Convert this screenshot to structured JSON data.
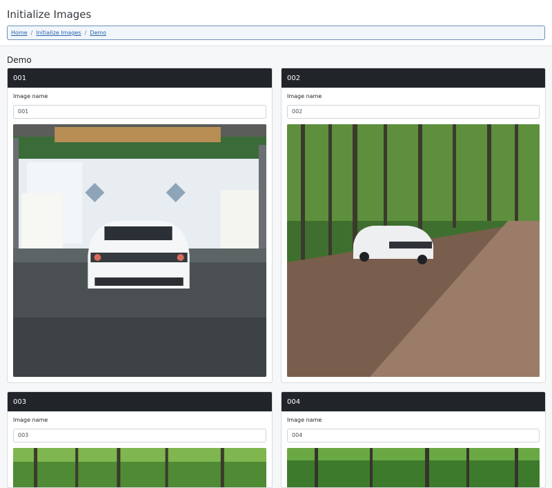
{
  "header": {
    "title": "Initialize Images",
    "breadcrumb": [
      {
        "label": "Home"
      },
      {
        "label": "Initialize Images"
      },
      {
        "label": "Demo"
      }
    ]
  },
  "section": {
    "title": "Demo"
  },
  "cards": [
    {
      "id": "001",
      "field_label": "Image name",
      "value": "001"
    },
    {
      "id": "002",
      "field_label": "Image name",
      "value": "002"
    },
    {
      "id": "003",
      "field_label": "Image name",
      "value": "003"
    },
    {
      "id": "004",
      "field_label": "Image name",
      "value": "004"
    }
  ],
  "colors": {
    "card_header": "#212529",
    "link": "#2a63a8",
    "breadcrumb_border": "#6d8fb3"
  }
}
